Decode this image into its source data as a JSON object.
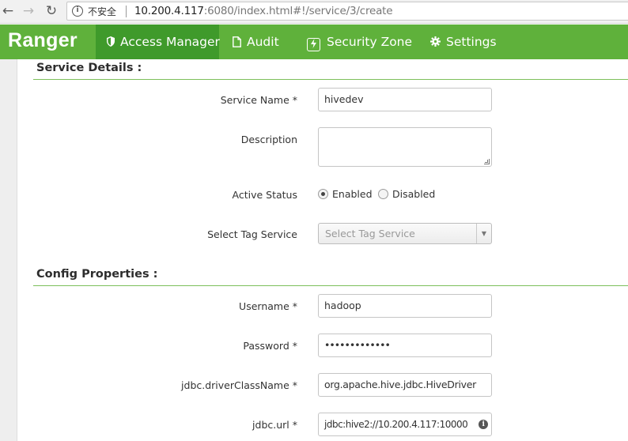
{
  "browser": {
    "security_label": "不安全",
    "url_host": "10.200.4.117",
    "url_rest": ":6080/index.html#!/service/3/create"
  },
  "navbar": {
    "brand": "Ranger",
    "items": [
      {
        "label": "Access Manager",
        "icon": "shield-icon",
        "active": true
      },
      {
        "label": "Audit",
        "icon": "document-icon",
        "active": false
      },
      {
        "label": "Security Zone",
        "icon": "lightning-icon",
        "active": false
      },
      {
        "label": "Settings",
        "icon": "gear-icon",
        "active": false
      }
    ]
  },
  "service_details": {
    "title": "Service Details :",
    "service_name_label": "Service Name *",
    "service_name_value": "hivedev",
    "description_label": "Description",
    "description_value": "",
    "active_status_label": "Active Status",
    "status_enabled_label": "Enabled",
    "status_disabled_label": "Disabled",
    "status_selected": "Enabled",
    "tag_service_label": "Select Tag Service",
    "tag_service_placeholder": "Select Tag Service"
  },
  "config_properties": {
    "title": "Config Properties :",
    "username_label": "Username *",
    "username_value": "hadoop",
    "password_label": "Password *",
    "password_value": "•••••••••••••",
    "driver_label": "jdbc.driverClassName *",
    "driver_value": "org.apache.hive.jdbc.HiveDriver",
    "url_label": "jdbc.url *",
    "url_value": "jdbc:hive2://10.200.4.117:10000"
  },
  "colors": {
    "navbar": "#5fb13b",
    "navbar_active": "#3f9a2b",
    "section_rule": "#7dbf5b"
  }
}
